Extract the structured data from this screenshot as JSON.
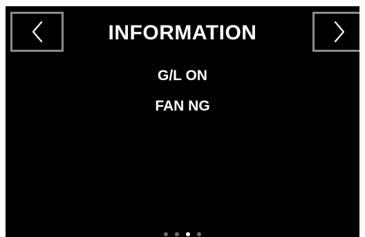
{
  "header": {
    "title": "INFORMATION",
    "prev_icon": "chevron-left-icon",
    "next_icon": "chevron-right-icon"
  },
  "info": {
    "items": [
      {
        "text": "G/L ON"
      },
      {
        "text": "FAN NG"
      }
    ]
  },
  "pagination": {
    "total_pages": 4,
    "current_page": 3
  },
  "colors": {
    "background": "#000000",
    "text": "#ffffff",
    "button_border": "#8c8c8c",
    "dot_inactive": "#6e6e6e",
    "dot_active": "#ffffff"
  }
}
